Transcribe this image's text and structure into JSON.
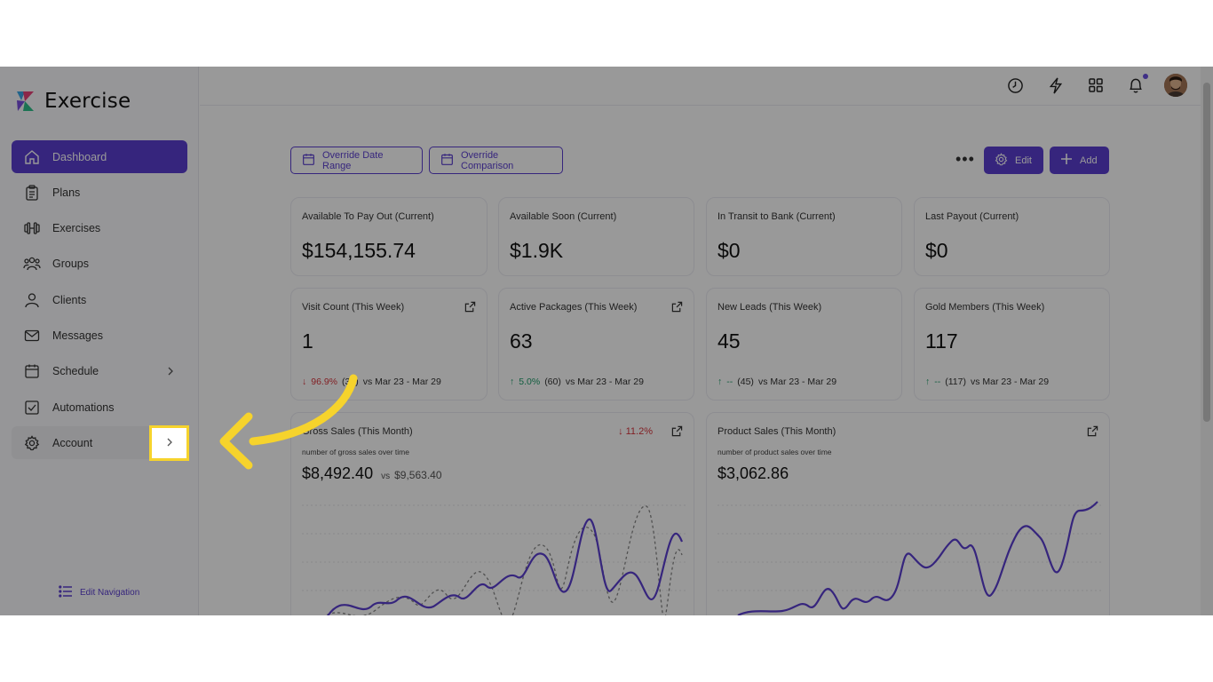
{
  "app": {
    "name": "Exercise"
  },
  "sidebar": {
    "items": [
      {
        "label": "Dashboard",
        "icon": "home-icon"
      },
      {
        "label": "Plans",
        "icon": "clipboard-icon"
      },
      {
        "label": "Exercises",
        "icon": "dumbbell-icon"
      },
      {
        "label": "Groups",
        "icon": "users-icon"
      },
      {
        "label": "Clients",
        "icon": "user-icon"
      },
      {
        "label": "Messages",
        "icon": "mail-icon"
      },
      {
        "label": "Schedule",
        "icon": "calendar-icon"
      },
      {
        "label": "Automations",
        "icon": "checkbox-icon"
      },
      {
        "label": "Account",
        "icon": "gear-icon"
      }
    ],
    "edit_navigation": "Edit Navigation"
  },
  "toolbar": {
    "override_date_range": "Override Date Range",
    "override_comparison": "Override Comparison",
    "more": "•••",
    "edit": "Edit",
    "add": "Add"
  },
  "cards_row1": [
    {
      "label": "Available To Pay Out (Current)",
      "value": "$154,155.74"
    },
    {
      "label": "Available Soon (Current)",
      "value": "$1.9K"
    },
    {
      "label": "In Transit to Bank (Current)",
      "value": "$0"
    },
    {
      "label": "Last Payout (Current)",
      "value": "$0"
    }
  ],
  "cards_row2": [
    {
      "label": "Visit Count (This Week)",
      "value": "1",
      "change": "96.9%",
      "prev": "(32)",
      "period": "vs Mar 23 - Mar 29",
      "direction": "down"
    },
    {
      "label": "Active Packages (This Week)",
      "value": "63",
      "change": "5.0%",
      "prev": "(60)",
      "period": "vs Mar 23 - Mar 29",
      "direction": "up"
    },
    {
      "label": "New Leads (This Week)",
      "value": "45",
      "change": "--",
      "prev": "(45)",
      "period": "vs Mar 23 - Mar 29",
      "direction": "up"
    },
    {
      "label": "Gold Members (This Week)",
      "value": "117",
      "change": "--",
      "prev": "(117)",
      "period": "vs Mar 23 - Mar 29",
      "direction": "up"
    }
  ],
  "charts": {
    "gross": {
      "label": "Gross Sales (This Month)",
      "subtitle": "number of gross sales over time",
      "value": "$8,492.40",
      "vs": "vs",
      "compare_value": "$9,563.40",
      "change": "11.2%"
    },
    "product": {
      "label": "Product Sales (This Month)",
      "subtitle": "number of product sales over time",
      "value": "$3,062.86"
    }
  },
  "colors": {
    "accent": "#5b3fd1",
    "down": "#d9363e",
    "up": "#1f9d6b",
    "highlight": "#f6d32c"
  }
}
